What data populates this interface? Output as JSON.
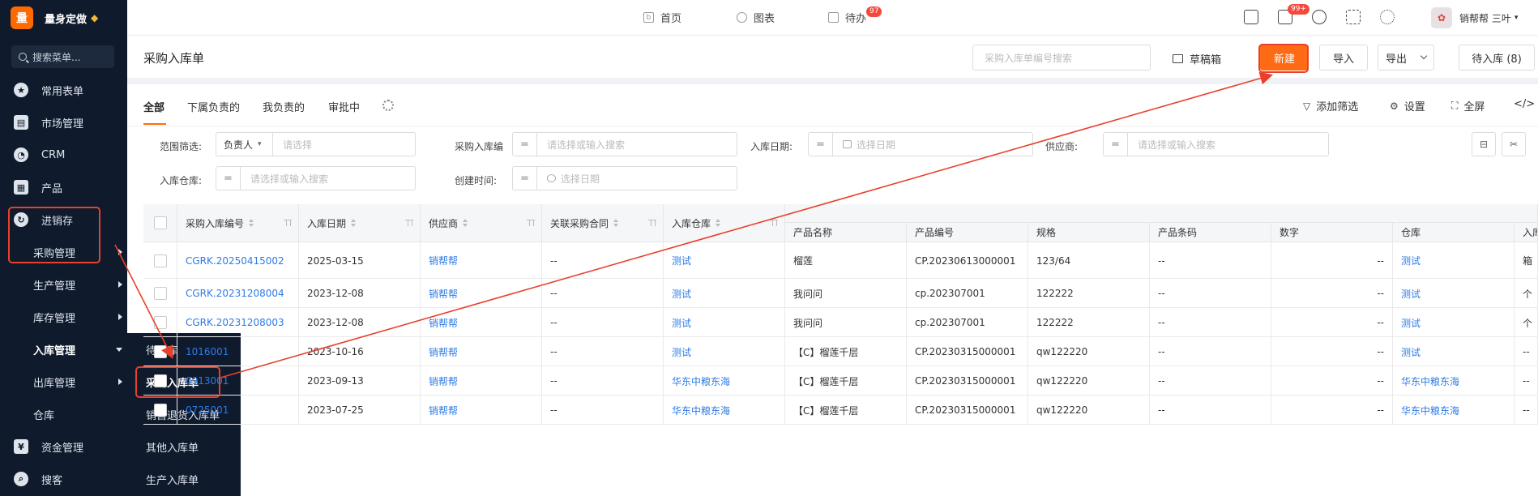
{
  "app": {
    "logo_char": "量",
    "name": "量身定做"
  },
  "sidebar": {
    "search_placeholder": "搜索菜单...",
    "items": [
      {
        "label": "常用表单",
        "icon": "star-icon"
      },
      {
        "label": "市场管理",
        "icon": "clipboard-icon"
      },
      {
        "label": "CRM",
        "icon": "pie-chart-icon"
      },
      {
        "label": "产品",
        "icon": "hierarchy-icon"
      },
      {
        "label": "进销存",
        "icon": "cycle-icon"
      }
    ],
    "subitems": [
      {
        "label": "采购管理"
      },
      {
        "label": "生产管理"
      },
      {
        "label": "库存管理"
      },
      {
        "label": "入库管理"
      },
      {
        "label": "出库管理"
      },
      {
        "label": "仓库"
      }
    ],
    "bottom": [
      {
        "label": "资金管理",
        "icon": "money-icon"
      },
      {
        "label": "搜客",
        "icon": "search-icon"
      }
    ],
    "flyout": [
      "待入库",
      "采购入库单",
      "销售退货入库单",
      "其他入库单",
      "生产入库单"
    ]
  },
  "topbar": {
    "tabs": [
      {
        "label": "首页"
      },
      {
        "label": "图表"
      },
      {
        "label": "待办",
        "badge": "97"
      }
    ],
    "message_badge": "99+",
    "user_name": "销帮帮 三叶"
  },
  "page": {
    "title": "采购入库单",
    "search_placeholder": "采购入库单编号搜索",
    "draft_label": "草稿箱",
    "new_button": "新建",
    "import_button": "导入",
    "export_button": "导出",
    "pending_button": "待入库 (8)"
  },
  "subtabs": {
    "items": [
      "全部",
      "下属负责的",
      "我负责的",
      "审批中"
    ],
    "add_filter": "添加筛选",
    "settings": "设置",
    "fullscreen": "全屏",
    "code_glyph": "</>"
  },
  "filters": {
    "scope_label": "范围筛选:",
    "scope_select": "负责人",
    "scope_placeholder": "请选择",
    "order_label": "采购入库编",
    "order_placeholder": "请选择或输入搜索",
    "date_label": "入库日期:",
    "date_placeholder": "选择日期",
    "supplier_label": "供应商:",
    "supplier_placeholder": "请选择或输入搜索",
    "warehouse_label": "入库仓库:",
    "warehouse_placeholder": "请选择或输入搜索",
    "created_label": "创建时间:",
    "created_placeholder": "选择日期",
    "op": "="
  },
  "table": {
    "headers": [
      "采购入库编号",
      "入库日期",
      "供应商",
      "关联采购合同",
      "入库仓库"
    ],
    "product_headers": [
      "产品名称",
      "产品编号",
      "规格",
      "产品条码",
      "数字",
      "仓库",
      "入库"
    ],
    "rows": [
      [
        "CGRK.20250415002",
        "2025-03-15",
        "销帮帮",
        "--",
        "测试",
        "榴莲",
        "CP.20230613000001",
        "123/64",
        "--",
        "--",
        "测试",
        "箱"
      ],
      [
        "CGRK.20231208004",
        "2023-12-08",
        "销帮帮",
        "--",
        "测试",
        "我问问",
        "cp.202307001",
        "122222",
        "--",
        "--",
        "测试",
        "个"
      ],
      [
        "CGRK.20231208003",
        "2023-12-08",
        "销帮帮",
        "--",
        "测试",
        "我问问",
        "cp.202307001",
        "122222",
        "--",
        "--",
        "测试",
        "个"
      ],
      [
        "1016001",
        "2023-10-16",
        "销帮帮",
        "--",
        "测试",
        "【C】榴莲千层",
        "CP.20230315000001",
        "qw122220",
        "--",
        "--",
        "测试",
        "--"
      ],
      [
        "0913001",
        "2023-09-13",
        "销帮帮",
        "--",
        "华东中粮东海",
        "【C】榴莲千层",
        "CP.20230315000001",
        "qw122220",
        "--",
        "--",
        "华东中粮东海",
        "--"
      ],
      [
        "0725001",
        "2023-07-25",
        "销帮帮",
        "--",
        "华东中粮东海",
        "【C】榴莲千层",
        "CP.20230315000001",
        "qw122220",
        "--",
        "--",
        "华东中粮东海",
        "--"
      ]
    ]
  },
  "colors": {
    "accent": "#ff6a14",
    "sidebar_bg": "#0f1b2d",
    "link": "#2d7be5",
    "annotation": "#e8402c"
  }
}
